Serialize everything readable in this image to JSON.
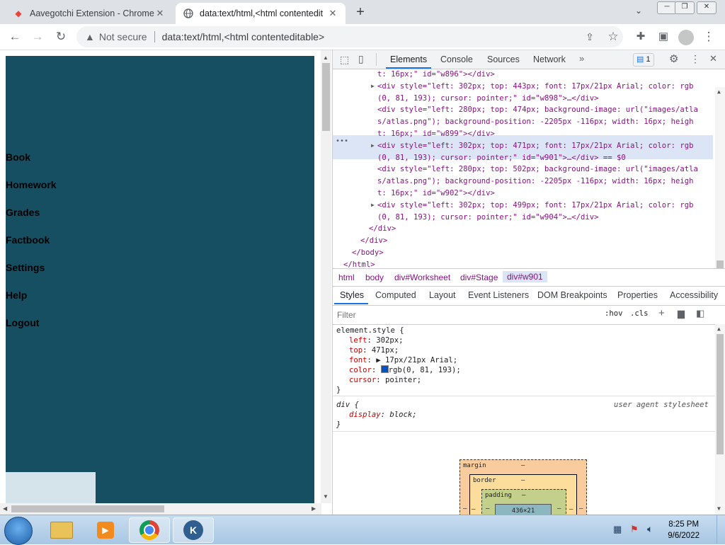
{
  "browser": {
    "tabs": [
      {
        "title": "Aavegotchi Extension - Chrome W",
        "active": false
      },
      {
        "title": "data:text/html,<html contentedit",
        "active": true
      }
    ],
    "security_label": "Not secure",
    "url": "data:text/html,<html contenteditable>"
  },
  "page": {
    "stage_color": "#174f62",
    "nav_links": [
      "Book",
      "Homework",
      "Grades",
      "Factbook",
      "Settings",
      "Help",
      "Logout"
    ]
  },
  "devtools": {
    "tabs": [
      "Elements",
      "Console",
      "Sources",
      "Network"
    ],
    "issues_count": "1",
    "dom_lines": [
      {
        "indent": 0,
        "arrow": "",
        "text": "t: 16px;\" id=\"w896\"></div>"
      },
      {
        "indent": 1,
        "arrow": "▶",
        "text": "<div style=\"left: 302px; top: 443px; font: 17px/21px Arial; color: rgb"
      },
      {
        "indent": 1,
        "arrow": "",
        "text": "(0, 81, 193); cursor: pointer;\" id=\"w898\">…</div>"
      },
      {
        "indent": 1,
        "arrow": "",
        "text": "<div style=\"left: 280px; top: 474px; background-image: url(\"images/atla"
      },
      {
        "indent": 1,
        "arrow": "",
        "text": "s/atlas.png\"); background-position: -2205px -116px; width: 16px; heigh"
      },
      {
        "indent": 1,
        "arrow": "",
        "text": "t: 16px;\" id=\"w899\"></div>"
      },
      {
        "indent": 1,
        "arrow": "▶",
        "text": "<div style=\"left: 302px; top: 471px; font: 17px/21px Arial; color: rgb"
      },
      {
        "indent": 1,
        "arrow": "",
        "text": "(0, 81, 193); cursor: pointer;\" id=\"w901\">…</div> == $0"
      },
      {
        "indent": 1,
        "arrow": "",
        "text": "<div style=\"left: 280px; top: 502px; background-image: url(\"images/atla"
      },
      {
        "indent": 1,
        "arrow": "",
        "text": "s/atlas.png\"); background-position: -2205px -116px; width: 16px; heigh"
      },
      {
        "indent": 1,
        "arrow": "",
        "text": "t: 16px;\" id=\"w902\"></div>"
      },
      {
        "indent": 1,
        "arrow": "▶",
        "text": "<div style=\"left: 302px; top: 499px; font: 17px/21px Arial; color: rgb"
      },
      {
        "indent": 1,
        "arrow": "",
        "text": "(0, 81, 193); cursor: pointer;\" id=\"w904\">…</div>"
      },
      {
        "indent": 2,
        "arrow": "",
        "text": "</div>"
      },
      {
        "indent": 3,
        "arrow": "",
        "text": "</div>"
      },
      {
        "indent": 4,
        "arrow": "",
        "text": "</body>"
      },
      {
        "indent": 5,
        "arrow": "",
        "text": "</html>"
      }
    ],
    "breadcrumbs": [
      "html",
      "body",
      "div#Worksheet",
      "div#Stage",
      "div#w901"
    ],
    "styles_tabs": [
      "Styles",
      "Computed",
      "Layout",
      "Event Listeners",
      "DOM Breakpoints",
      "Properties",
      "Accessibility"
    ],
    "filter_placeholder": "Filter",
    "hov": ":hov",
    "cls": ".cls",
    "element_style": {
      "selector": "element.style {",
      "props": [
        {
          "name": "left",
          "value": "302px;"
        },
        {
          "name": "top",
          "value": "471px;"
        },
        {
          "name": "font",
          "value": "▶ 17px/21px Arial;"
        },
        {
          "name": "color",
          "value": "rgb(0, 81, 193);"
        },
        {
          "name": "cursor",
          "value": "pointer;"
        }
      ],
      "close": "}"
    },
    "ua_rule": {
      "selector": "div {",
      "source": "user agent stylesheet",
      "prop": "display",
      "value": "block;",
      "close": "}"
    },
    "box_model": {
      "margin": "margin",
      "border": "border",
      "padding": "padding",
      "dash": "–",
      "content": "436×21"
    }
  },
  "taskbar": {
    "time": "8:25 PM",
    "date": "9/6/2022"
  }
}
